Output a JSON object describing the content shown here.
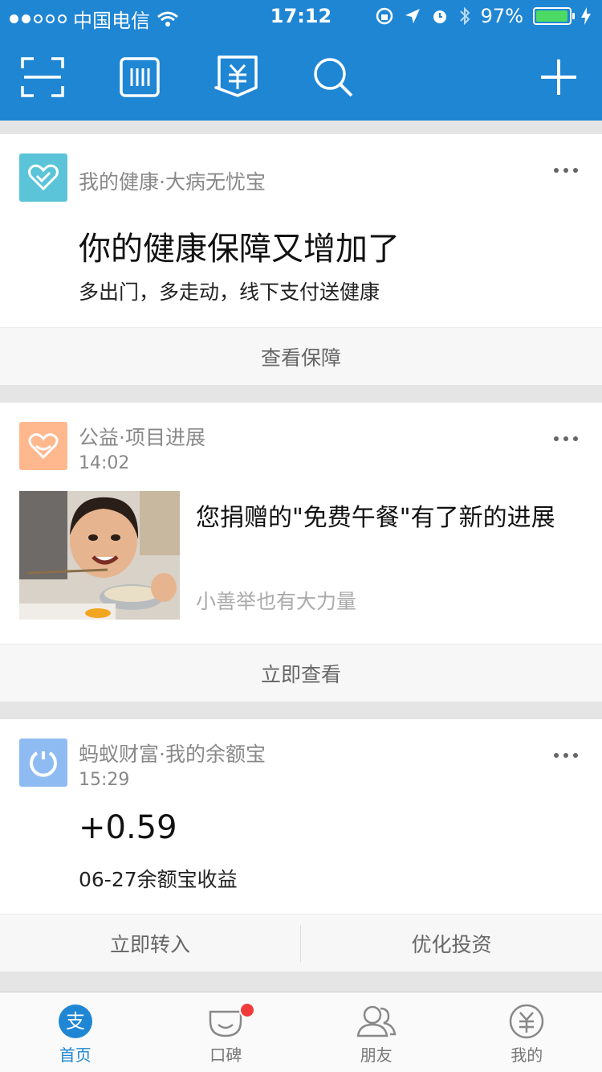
{
  "status_bar": {
    "carrier": "中国电信",
    "time": "17:12",
    "battery": "97%",
    "battery_level": 0.97
  },
  "toolbar": {
    "icons": [
      "scan-icon",
      "barcode-icon",
      "pay-icon",
      "search-icon",
      "add-icon"
    ]
  },
  "cards": [
    {
      "source": "我的健康·大病无忧宝",
      "title": "你的健康保障又增加了",
      "desc": "多出门，多走动，线下支付送健康",
      "action": "查看保障",
      "icon_color": "#5bc4d8"
    },
    {
      "source": "公益·项目进展",
      "time": "14:02",
      "title": "您捐赠的\"免费午餐\"有了新的进展",
      "desc": "小善举也有大力量",
      "action": "立即查看",
      "icon_color": "#ffb78d"
    },
    {
      "source": "蚂蚁财富·我的余额宝",
      "time": "15:29",
      "amount": "+0.59",
      "desc": "06-27余额宝收益",
      "actions": [
        "立即转入",
        "优化投资"
      ],
      "icon_color": "#8fbbf3"
    }
  ],
  "tabbar": {
    "tabs": [
      {
        "label": "首页",
        "icon": "alipay-home-icon",
        "active": true
      },
      {
        "label": "口碑",
        "icon": "koubei-icon",
        "badge": true
      },
      {
        "label": "朋友",
        "icon": "friends-icon"
      },
      {
        "label": "我的",
        "icon": "wallet-icon"
      }
    ]
  },
  "colors": {
    "brand_blue": "#1f86d4",
    "badge_red": "#f23c3c",
    "battery_green": "#4cd964"
  }
}
